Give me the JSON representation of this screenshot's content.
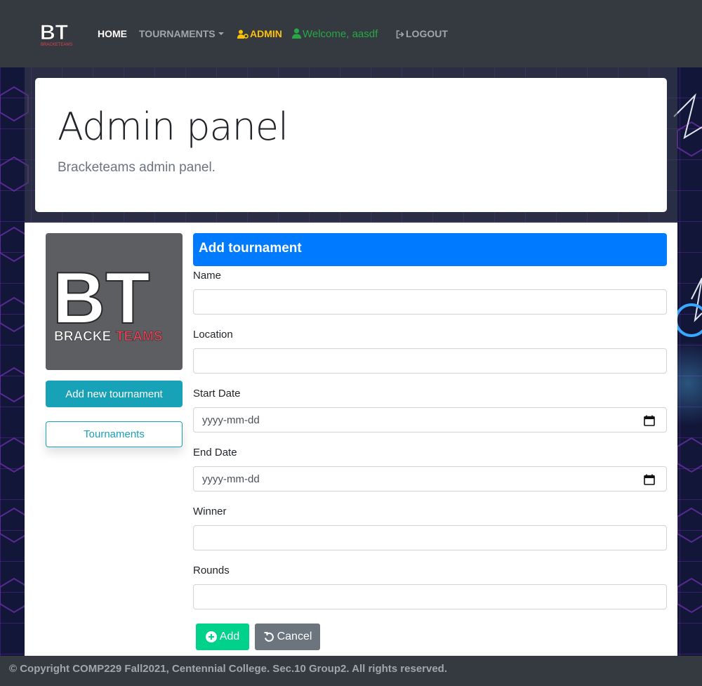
{
  "navbar": {
    "brand": "BT",
    "brand_sub": "BRACKETEAMS",
    "home": "HOME",
    "tournaments": "TOURNAMENTS",
    "admin": "ADMIN",
    "welcome": "Welcome, aasdf",
    "logout": "LOGOUT"
  },
  "jumbotron": {
    "title": "Admin panel",
    "subtitle": "Bracketeams admin panel."
  },
  "sidebar": {
    "logo_text": "BT",
    "logo_sub_a": "BRACKE",
    "logo_sub_b": "TEAMS",
    "add_new_label": "Add new tournament",
    "tournaments_label": "Tournaments"
  },
  "form": {
    "title": "Add tournament",
    "name_label": "Name",
    "name_value": "",
    "location_label": "Location",
    "location_value": "",
    "start_label": "Start Date",
    "start_placeholder": "yyyy-mm-dd",
    "end_label": "End Date",
    "end_placeholder": "yyyy-mm-dd",
    "winner_label": "Winner",
    "winner_value": "",
    "rounds_label": "Rounds",
    "rounds_value": "",
    "add_label": "Add",
    "cancel_label": "Cancel"
  },
  "footer": {
    "text": "© Copyright COMP229 Fall2021, Centennial College. Sec.10 Group2. All rights reserved."
  },
  "colors": {
    "navbar": "#343a40",
    "primary": "#007bff",
    "info": "#17a2b8",
    "admin": "#ffc107",
    "welcome": "#28a745",
    "add_button": "#00d28c",
    "cancel_button": "#6c757d"
  },
  "icons": {
    "admin": "user-cog-icon",
    "welcome": "user-icon",
    "logout": "sign-out-icon",
    "add": "plus-circle-icon",
    "cancel": "undo-icon",
    "date": "calendar-icon"
  }
}
